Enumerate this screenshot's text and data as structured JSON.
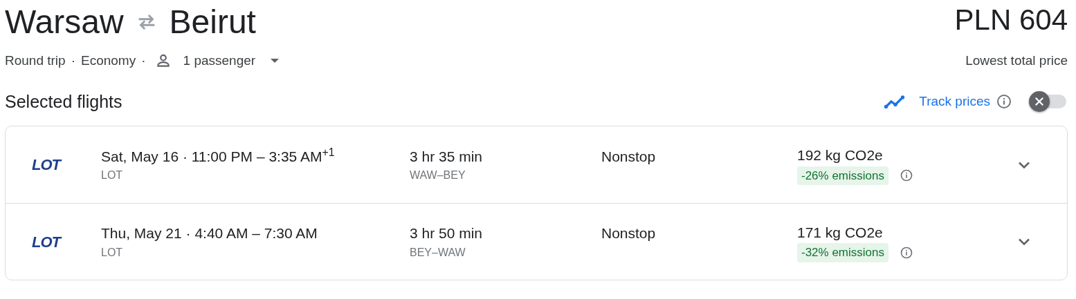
{
  "route": {
    "origin": "Warsaw",
    "destination": "Beirut"
  },
  "price": {
    "amount": "PLN 604",
    "caption": "Lowest total price"
  },
  "trip_options": [
    {
      "kind": "text",
      "label": "Round trip"
    },
    {
      "kind": "separator",
      "label": "·"
    },
    {
      "kind": "text",
      "label": "Economy"
    },
    {
      "kind": "separator",
      "label": "·"
    },
    {
      "kind": "dropdown",
      "label": "1 passenger"
    }
  ],
  "section_title": "Selected flights",
  "track_prices": {
    "label": "Track prices",
    "on": false
  },
  "flights": [
    {
      "logo": "LOT",
      "times": "Sat, May 16 · 11:00 PM – 3:35 AM$^{+1}$",
      "airline": "LOT",
      "duration": "3 hr 35 min",
      "route": "WAW–BEY",
      "stops": "Nonstop",
      "emissions": "192 kg CO2e",
      "emissions_change": "-26% emissions",
      "expanded": false
    },
    {
      "logo": "LOT",
      "times": "Thu, May 21 · 4:40 AM – 7:30 AM",
      "airline": "LOT",
      "duration": "3 hr 50 min",
      "route": "BEY–WAW",
      "stops": "Nonstop",
      "emissions": "171 kg CO2e",
      "emissions_change": "-32% emissions",
      "expanded": false
    }
  ]
}
